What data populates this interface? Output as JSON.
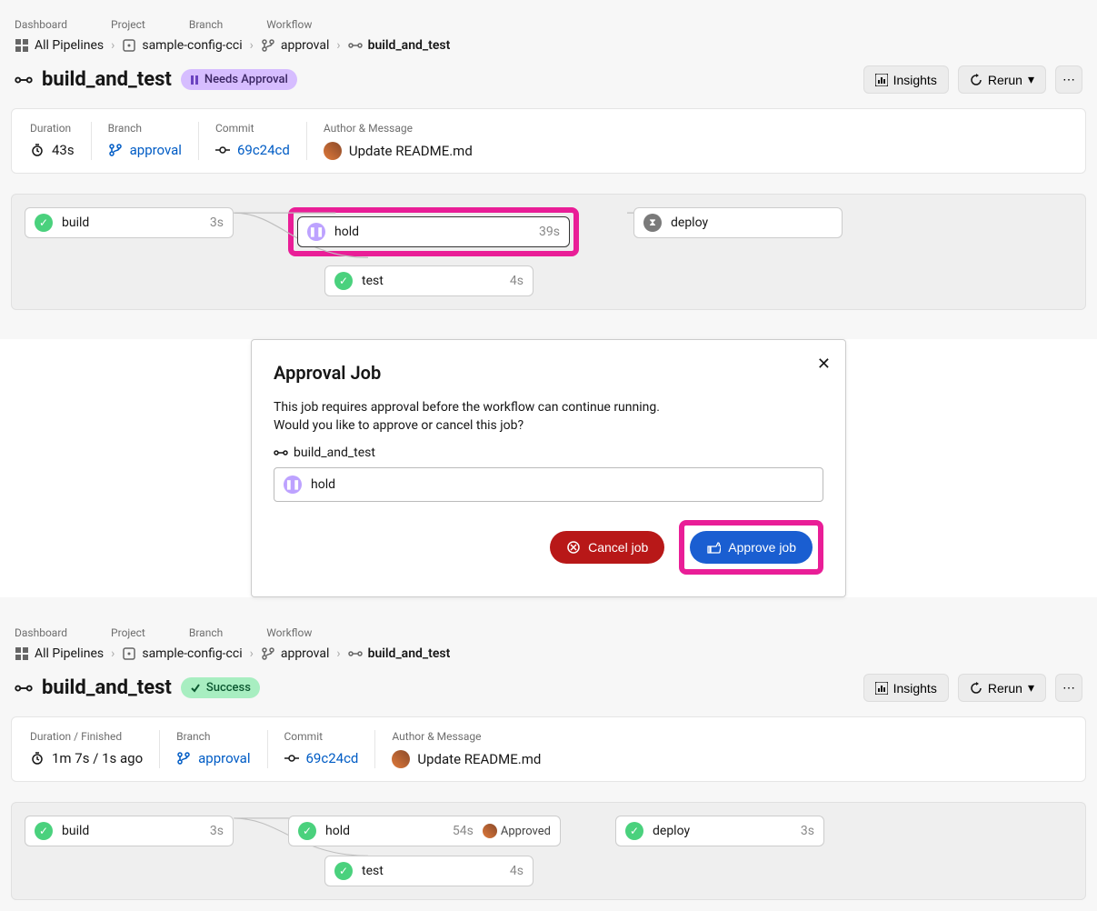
{
  "panel1": {
    "breadcrumbs": {
      "dashboard": "Dashboard",
      "project": "Project",
      "branch": "Branch",
      "workflow": "Workflow"
    },
    "bc_links": {
      "all_pipelines": "All Pipelines",
      "project": "sample-config-cci",
      "branch": "approval",
      "workflow": "build_and_test"
    },
    "title": "build_and_test",
    "status_badge": "Needs Approval",
    "actions": {
      "insights": "Insights",
      "rerun": "Rerun"
    },
    "meta": {
      "duration_label": "Duration",
      "duration_val": "43s",
      "branch_label": "Branch",
      "branch_val": "approval",
      "commit_label": "Commit",
      "commit_val": "69c24cd",
      "author_label": "Author & Message",
      "author_val": "Update README.md"
    },
    "jobs": {
      "build": {
        "name": "build",
        "time": "3s"
      },
      "hold": {
        "name": "hold",
        "time": "39s"
      },
      "test": {
        "name": "test",
        "time": "4s"
      },
      "deploy": {
        "name": "deploy",
        "time": ""
      }
    }
  },
  "modal": {
    "title": "Approval Job",
    "text1": "This job requires approval before the workflow can continue running.",
    "text2": "Would you like to approve or cancel this job?",
    "workflow": "build_and_test",
    "job": "hold",
    "cancel": "Cancel job",
    "approve": "Approve job"
  },
  "panel2": {
    "breadcrumbs": {
      "dashboard": "Dashboard",
      "project": "Project",
      "branch": "Branch",
      "workflow": "Workflow"
    },
    "bc_links": {
      "all_pipelines": "All Pipelines",
      "project": "sample-config-cci",
      "branch": "approval",
      "workflow": "build_and_test"
    },
    "title": "build_and_test",
    "status_badge": "Success",
    "actions": {
      "insights": "Insights",
      "rerun": "Rerun"
    },
    "meta": {
      "duration_label": "Duration / Finished",
      "duration_val": "1m 7s / 1s ago",
      "branch_label": "Branch",
      "branch_val": "approval",
      "commit_label": "Commit",
      "commit_val": "69c24cd",
      "author_label": "Author & Message",
      "author_val": "Update README.md"
    },
    "jobs": {
      "build": {
        "name": "build",
        "time": "3s"
      },
      "hold": {
        "name": "hold",
        "time": "54s",
        "approved": "Approved"
      },
      "test": {
        "name": "test",
        "time": "4s"
      },
      "deploy": {
        "name": "deploy",
        "time": "3s"
      }
    }
  }
}
